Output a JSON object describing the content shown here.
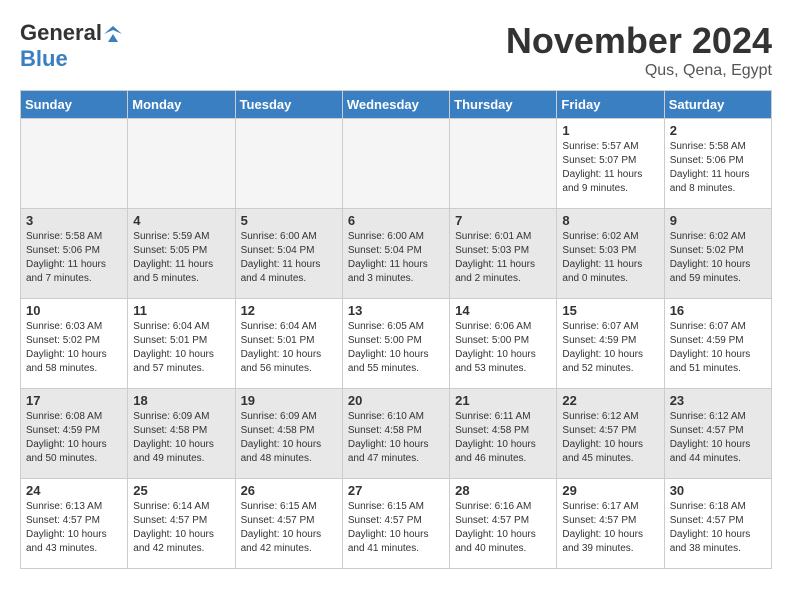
{
  "logo": {
    "line1": "General",
    "line2": "Blue"
  },
  "header": {
    "title": "November 2024",
    "location": "Qus, Qena, Egypt"
  },
  "weekdays": [
    "Sunday",
    "Monday",
    "Tuesday",
    "Wednesday",
    "Thursday",
    "Friday",
    "Saturday"
  ],
  "weeks": [
    [
      {
        "day": "",
        "info": ""
      },
      {
        "day": "",
        "info": ""
      },
      {
        "day": "",
        "info": ""
      },
      {
        "day": "",
        "info": ""
      },
      {
        "day": "",
        "info": ""
      },
      {
        "day": "1",
        "info": "Sunrise: 5:57 AM\nSunset: 5:07 PM\nDaylight: 11 hours\nand 9 minutes."
      },
      {
        "day": "2",
        "info": "Sunrise: 5:58 AM\nSunset: 5:06 PM\nDaylight: 11 hours\nand 8 minutes."
      }
    ],
    [
      {
        "day": "3",
        "info": "Sunrise: 5:58 AM\nSunset: 5:06 PM\nDaylight: 11 hours\nand 7 minutes."
      },
      {
        "day": "4",
        "info": "Sunrise: 5:59 AM\nSunset: 5:05 PM\nDaylight: 11 hours\nand 5 minutes."
      },
      {
        "day": "5",
        "info": "Sunrise: 6:00 AM\nSunset: 5:04 PM\nDaylight: 11 hours\nand 4 minutes."
      },
      {
        "day": "6",
        "info": "Sunrise: 6:00 AM\nSunset: 5:04 PM\nDaylight: 11 hours\nand 3 minutes."
      },
      {
        "day": "7",
        "info": "Sunrise: 6:01 AM\nSunset: 5:03 PM\nDaylight: 11 hours\nand 2 minutes."
      },
      {
        "day": "8",
        "info": "Sunrise: 6:02 AM\nSunset: 5:03 PM\nDaylight: 11 hours\nand 0 minutes."
      },
      {
        "day": "9",
        "info": "Sunrise: 6:02 AM\nSunset: 5:02 PM\nDaylight: 10 hours\nand 59 minutes."
      }
    ],
    [
      {
        "day": "10",
        "info": "Sunrise: 6:03 AM\nSunset: 5:02 PM\nDaylight: 10 hours\nand 58 minutes."
      },
      {
        "day": "11",
        "info": "Sunrise: 6:04 AM\nSunset: 5:01 PM\nDaylight: 10 hours\nand 57 minutes."
      },
      {
        "day": "12",
        "info": "Sunrise: 6:04 AM\nSunset: 5:01 PM\nDaylight: 10 hours\nand 56 minutes."
      },
      {
        "day": "13",
        "info": "Sunrise: 6:05 AM\nSunset: 5:00 PM\nDaylight: 10 hours\nand 55 minutes."
      },
      {
        "day": "14",
        "info": "Sunrise: 6:06 AM\nSunset: 5:00 PM\nDaylight: 10 hours\nand 53 minutes."
      },
      {
        "day": "15",
        "info": "Sunrise: 6:07 AM\nSunset: 4:59 PM\nDaylight: 10 hours\nand 52 minutes."
      },
      {
        "day": "16",
        "info": "Sunrise: 6:07 AM\nSunset: 4:59 PM\nDaylight: 10 hours\nand 51 minutes."
      }
    ],
    [
      {
        "day": "17",
        "info": "Sunrise: 6:08 AM\nSunset: 4:59 PM\nDaylight: 10 hours\nand 50 minutes."
      },
      {
        "day": "18",
        "info": "Sunrise: 6:09 AM\nSunset: 4:58 PM\nDaylight: 10 hours\nand 49 minutes."
      },
      {
        "day": "19",
        "info": "Sunrise: 6:09 AM\nSunset: 4:58 PM\nDaylight: 10 hours\nand 48 minutes."
      },
      {
        "day": "20",
        "info": "Sunrise: 6:10 AM\nSunset: 4:58 PM\nDaylight: 10 hours\nand 47 minutes."
      },
      {
        "day": "21",
        "info": "Sunrise: 6:11 AM\nSunset: 4:58 PM\nDaylight: 10 hours\nand 46 minutes."
      },
      {
        "day": "22",
        "info": "Sunrise: 6:12 AM\nSunset: 4:57 PM\nDaylight: 10 hours\nand 45 minutes."
      },
      {
        "day": "23",
        "info": "Sunrise: 6:12 AM\nSunset: 4:57 PM\nDaylight: 10 hours\nand 44 minutes."
      }
    ],
    [
      {
        "day": "24",
        "info": "Sunrise: 6:13 AM\nSunset: 4:57 PM\nDaylight: 10 hours\nand 43 minutes."
      },
      {
        "day": "25",
        "info": "Sunrise: 6:14 AM\nSunset: 4:57 PM\nDaylight: 10 hours\nand 42 minutes."
      },
      {
        "day": "26",
        "info": "Sunrise: 6:15 AM\nSunset: 4:57 PM\nDaylight: 10 hours\nand 42 minutes."
      },
      {
        "day": "27",
        "info": "Sunrise: 6:15 AM\nSunset: 4:57 PM\nDaylight: 10 hours\nand 41 minutes."
      },
      {
        "day": "28",
        "info": "Sunrise: 6:16 AM\nSunset: 4:57 PM\nDaylight: 10 hours\nand 40 minutes."
      },
      {
        "day": "29",
        "info": "Sunrise: 6:17 AM\nSunset: 4:57 PM\nDaylight: 10 hours\nand 39 minutes."
      },
      {
        "day": "30",
        "info": "Sunrise: 6:18 AM\nSunset: 4:57 PM\nDaylight: 10 hours\nand 38 minutes."
      }
    ]
  ]
}
